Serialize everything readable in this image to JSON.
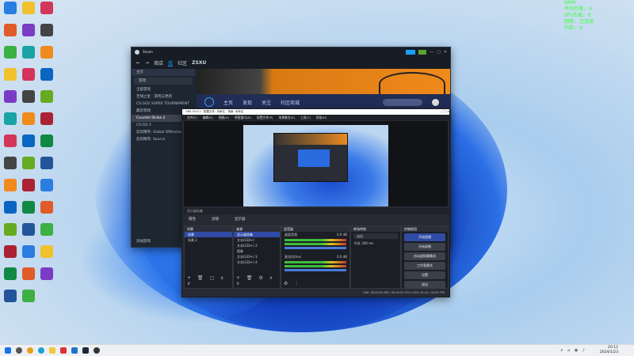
{
  "desktop": {
    "icons_col1": [
      "",
      "",
      "",
      "",
      "",
      "",
      "",
      "",
      "",
      "",
      "",
      "",
      "",
      ""
    ],
    "icons_col2": [
      "",
      "",
      "",
      "",
      "",
      "",
      "",
      "",
      "",
      "",
      "",
      "",
      "",
      ""
    ],
    "icons_col3": [
      "",
      "",
      "",
      "",
      "",
      "",
      "",
      "",
      "",
      "",
      "",
      "",
      ""
    ]
  },
  "sysmon": {
    "line1": "0000",
    "line2": "平均负载: 0",
    "line3": "GPU负载: 0",
    "line4": "网络: 已连接",
    "line5": "内存: 0"
  },
  "steam": {
    "title": "Steam",
    "nav_store": "商店",
    "nav_library": "库",
    "nav_community": "社区",
    "nav_user": "ZSXU",
    "sidebar_header": "主页",
    "sidebar_search": "游戏",
    "sidebar_rows": [
      "全部游戏",
      "无线之星 - 游戏与更新",
      "CS:GO2 SUPER TOURNAMENT",
      "最近游戏",
      "Counter-Strike 2",
      "CS:GO 2",
      "反恐精英: Global Offensive",
      "反恐精英: Source"
    ],
    "sidebar_footer": "添加游戏",
    "store_tabs": [
      "主页",
      "发现",
      "关注",
      "社区商城"
    ]
  },
  "obs": {
    "title": "OBS 30.0.2 - 配置文件: 未命名 - 场景: 未命名",
    "menu": [
      "文件(F)",
      "编辑(E)",
      "视图(V)",
      "停靠窗口(D)",
      "配置文件(P)",
      "场景集合(S)",
      "工具(T)",
      "帮助(H)"
    ],
    "scene_label": "显示器采集",
    "ctrl_props": "属性",
    "ctrl_filters": "滤镜",
    "ctrl_display": "显示器",
    "docks": {
      "scenes": {
        "title": "场景",
        "items": [
          "场景",
          "场景 2"
        ]
      },
      "sources": {
        "title": "来源",
        "items": [
          "显示器采集",
          "文本(GDI+)",
          "文本(GDI+) 2",
          "图像",
          "文本(GDI+) 3",
          "文本(GDI+) 4"
        ]
      },
      "mixer": {
        "title": "混音器",
        "ch1": "桌面音频",
        "ch1_db": "0.0 dB",
        "ch2": "麦克风/Aux",
        "ch2_db": "0.0 dB"
      },
      "transitions": {
        "title": "转场特效",
        "type": "淡出",
        "duration_label": "时长",
        "duration": "300 ms"
      },
      "controls": {
        "title": "控制按钮",
        "buttons": [
          "开始直播",
          "开始录制",
          "启动虚拟摄像机",
          "工作室模式",
          "设置",
          "退出"
        ]
      }
    },
    "status": "LIVE: 00:00:00   REC: 00:00:00   CPU: 0.6%   30.00 / 30.00 FPS"
  },
  "taskbar": {
    "time": "20:12",
    "date": "2024/1/23"
  }
}
